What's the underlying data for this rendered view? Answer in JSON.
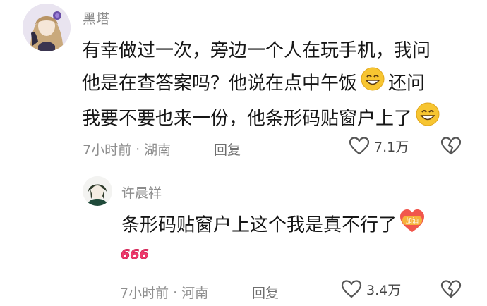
{
  "comment": {
    "username": "黑塔",
    "lines": [
      "有幸做过一次，旁边一个人在玩手机，我问",
      "他是在查答案吗？他说在点中午饭",
      "还问",
      "我要不要也来一份，他条形码贴窗户上了"
    ],
    "time": "7小时前",
    "location": "湖南",
    "reply_label": "回复",
    "likes": "7.1万",
    "emoji_name": "grin-emoji"
  },
  "reply": {
    "username": "许晨祥",
    "text": "条形码贴窗户上这个我是真不行了",
    "sticker_label": "加油",
    "extra_sticker": "666",
    "time": "7小时前",
    "location": "河南",
    "reply_label": "回复",
    "likes": "3.4万"
  },
  "separator": "·"
}
